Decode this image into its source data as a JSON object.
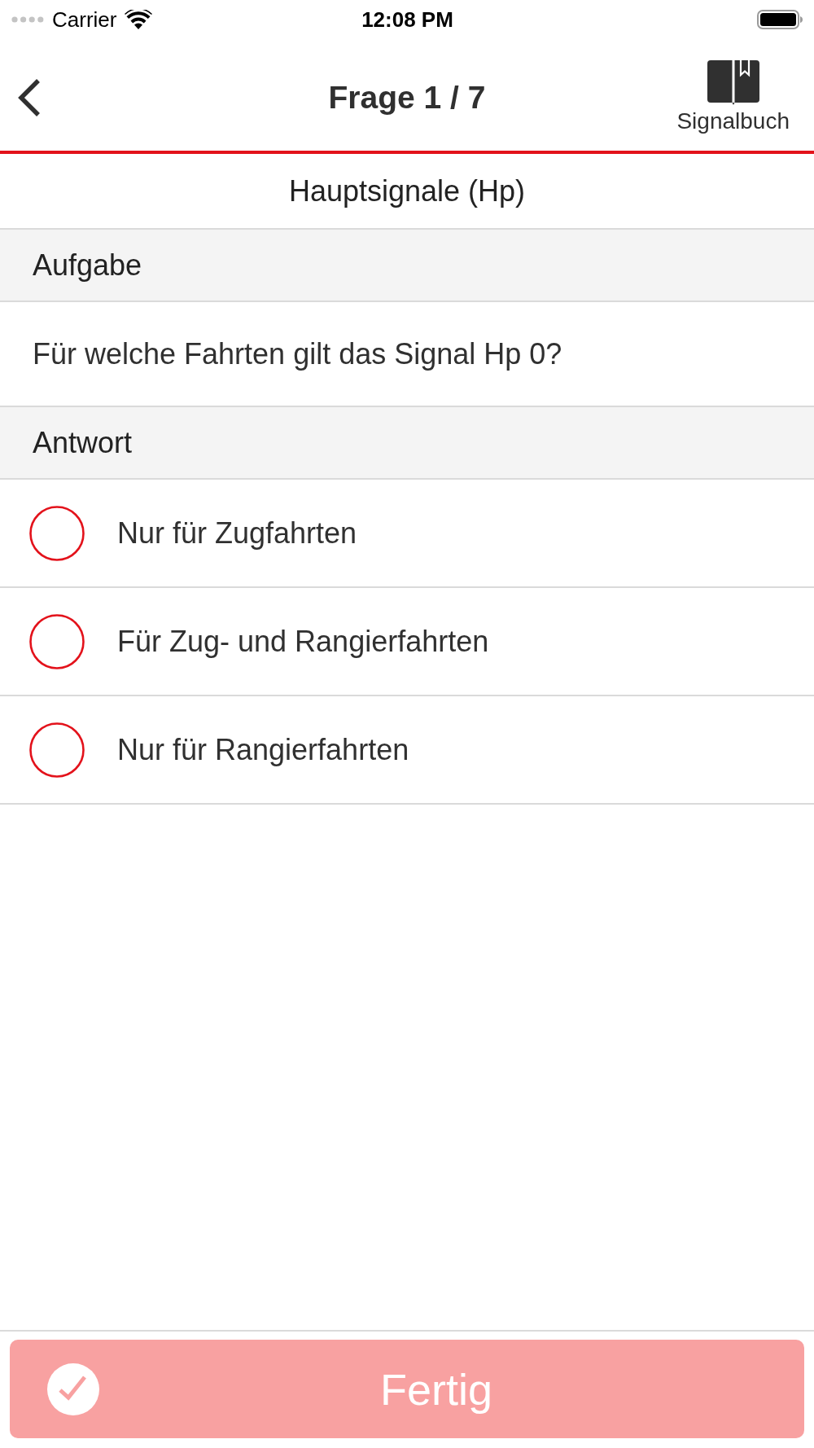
{
  "status_bar": {
    "carrier": "Carrier",
    "time": "12:08 PM"
  },
  "nav_bar": {
    "title": "Frage 1 / 7",
    "book_label": "Signalbuch"
  },
  "category": "Hauptsignale (Hp)",
  "task": {
    "header": "Aufgabe",
    "question": "Für welche Fahrten gilt das Signal Hp 0?"
  },
  "answer": {
    "header": "Antwort",
    "options": [
      {
        "label": "Nur für Zugfahrten",
        "selected": false
      },
      {
        "label": "Für Zug- und Rangierfahrten",
        "selected": false
      },
      {
        "label": "Nur für Rangierfahrten",
        "selected": false
      }
    ]
  },
  "done_button": {
    "label": "Fertig",
    "disabled": true
  }
}
